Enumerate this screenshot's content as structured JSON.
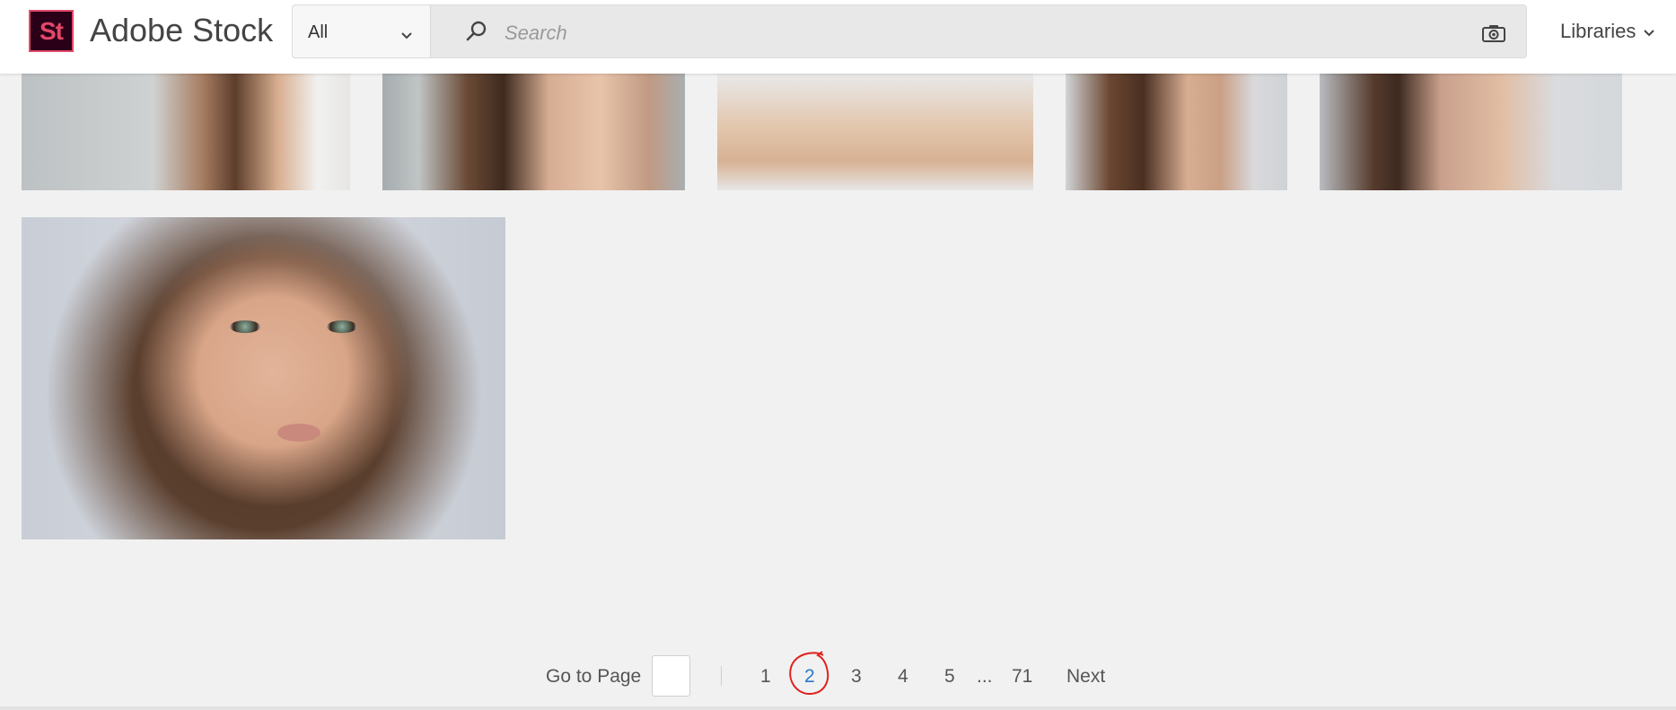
{
  "app": {
    "logo_text": "St",
    "brand_name": "Adobe Stock",
    "logo_color": "#e34869",
    "logo_bg": "#2a0019"
  },
  "search": {
    "scope_value": "All",
    "placeholder": "Search",
    "search_icon": "search-icon",
    "camera_icon": "camera-icon"
  },
  "nav": {
    "libraries_label": "Libraries"
  },
  "results": {
    "tiles": [
      {
        "subject": "woman-hair-portrait-1"
      },
      {
        "subject": "woman-hair-portrait-2"
      },
      {
        "subject": "woman-shoulders"
      },
      {
        "subject": "woman-hair-portrait-3"
      },
      {
        "subject": "woman-profile-shoulder"
      },
      {
        "subject": "woman-face-hands-portrait"
      }
    ]
  },
  "pagination": {
    "goto_label": "Go to Page",
    "goto_value": "",
    "pages": [
      "1",
      "2",
      "3",
      "4",
      "5"
    ],
    "ellipsis": "...",
    "last_page": "71",
    "next_label": "Next",
    "current_page": "2",
    "current_color": "#2a7ac9",
    "annotation_color": "#e0201c"
  }
}
